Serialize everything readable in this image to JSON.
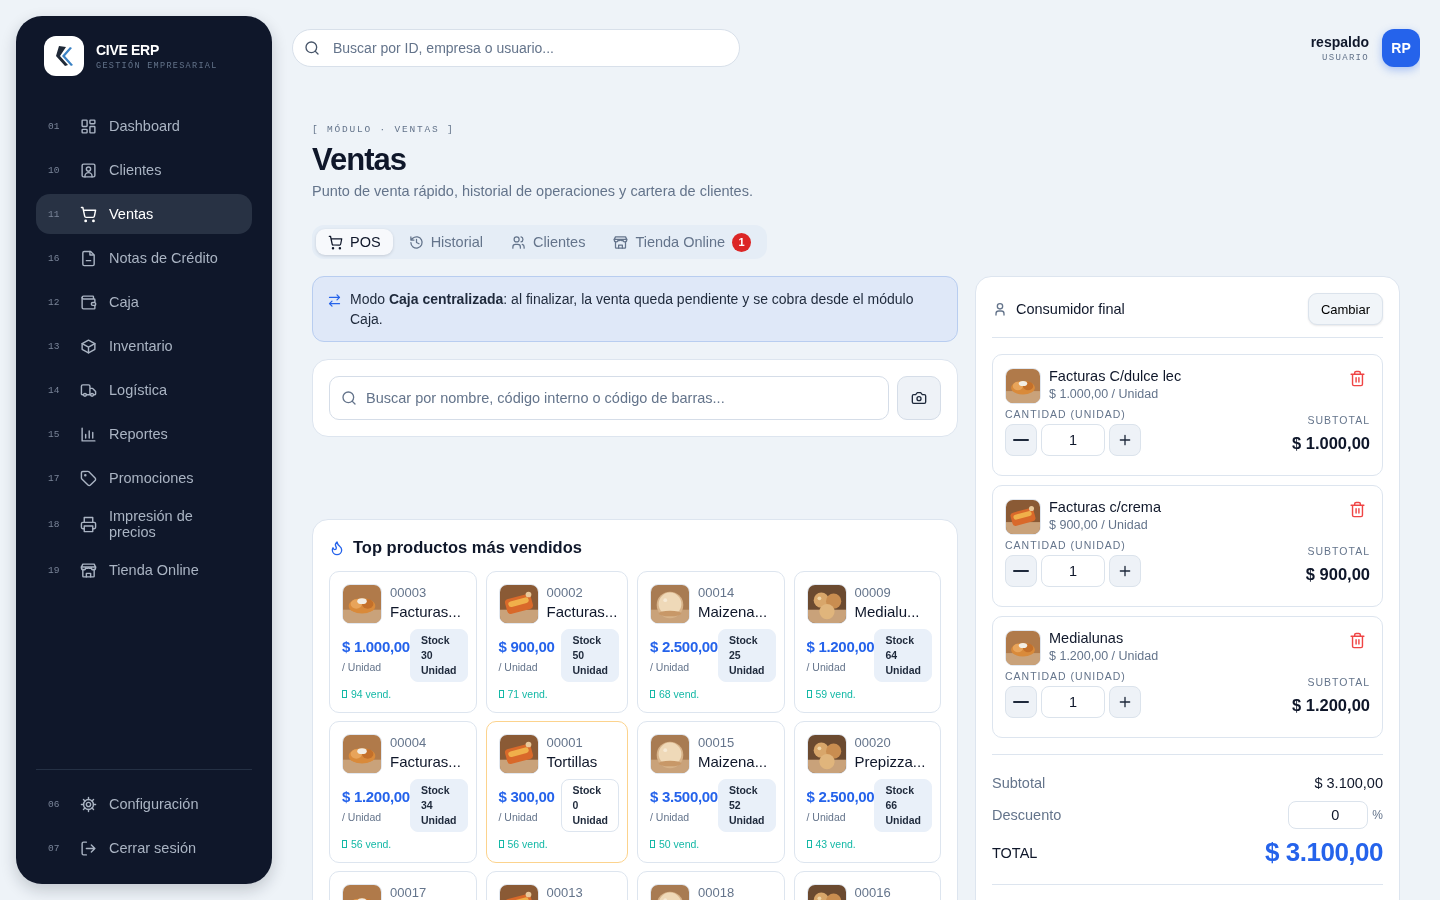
{
  "sidebar": {
    "brand": "CIVE ERP",
    "tagline": "GESTIÓN EMPRESARIAL",
    "items": [
      {
        "number": "01",
        "label": "Dashboard",
        "selected": false
      },
      {
        "number": "10",
        "label": "Clientes",
        "selected": false
      },
      {
        "number": "11",
        "label": "Ventas",
        "selected": true
      },
      {
        "number": "16",
        "label": "Notas de Crédito",
        "selected": false
      },
      {
        "number": "12",
        "label": "Caja",
        "selected": false
      },
      {
        "number": "13",
        "label": "Inventario",
        "selected": false
      },
      {
        "number": "14",
        "label": "Logística",
        "selected": false
      },
      {
        "number": "15",
        "label": "Reportes",
        "selected": false
      },
      {
        "number": "17",
        "label": "Promociones",
        "selected": false
      },
      {
        "number": "18",
        "label": "Impresión de precios",
        "selected": false
      },
      {
        "number": "19",
        "label": "Tienda Online",
        "selected": false
      }
    ],
    "footer_items": [
      {
        "number": "06",
        "label": "Configuración"
      },
      {
        "number": "07",
        "label": "Cerrar sesión"
      }
    ]
  },
  "topbar": {
    "search": {
      "placeholder": "Buscar por ID, empresa o usuario..."
    },
    "user": {
      "name": "respaldo",
      "role": "USUARIO",
      "initials": "RP"
    }
  },
  "header": {
    "breadcrumb": "[ MÓDULO · VENTAS ]",
    "title": "Ventas",
    "subtitle": "Punto de venta rápido, historial de operaciones y cartera de clientes."
  },
  "tabs": [
    {
      "label": "POS",
      "selected": true
    },
    {
      "label": "Historial",
      "selected": false
    },
    {
      "label": "Clientes",
      "selected": false
    },
    {
      "label": "Tienda Online",
      "selected": false,
      "badge": "1"
    }
  ],
  "notice": "Modo **Caja centralizada**: al finalizar, la venta queda pendiente y se cobra desde el módulo Caja.",
  "product_search": {
    "placeholder": "Buscar por nombre, código interno o código de barras..."
  },
  "top_products": {
    "title": "Top productos más vendidos",
    "products": [
      {
        "code": "00003",
        "name": "Facturas...",
        "price": "$ 1.000,00",
        "unit": "/ Unidad",
        "stock": "Stock\n30\nUnidad",
        "sold": "94 vend.",
        "out_of_stock": false
      },
      {
        "code": "00002",
        "name": "Facturas...",
        "price": "$ 900,00",
        "unit": "/ Unidad",
        "stock": "Stock\n50\nUnidad",
        "sold": "71 vend.",
        "out_of_stock": false
      },
      {
        "code": "00014",
        "name": "Maizena...",
        "price": "$ 2.500,00",
        "unit": "/ Unidad",
        "stock": "Stock\n25\nUnidad",
        "sold": "68 vend.",
        "out_of_stock": false
      },
      {
        "code": "00009",
        "name": "Medialu...",
        "price": "$ 1.200,00",
        "unit": "/ Unidad",
        "stock": "Stock\n64\nUnidad",
        "sold": "59 vend.",
        "out_of_stock": false
      },
      {
        "code": "00004",
        "name": "Facturas...",
        "price": "$ 1.200,00",
        "unit": "/ Unidad",
        "stock": "Stock\n34\nUnidad",
        "sold": "56 vend.",
        "out_of_stock": false
      },
      {
        "code": "00001",
        "name": "Tortillas",
        "price": "$ 300,00",
        "unit": "/ Unidad",
        "stock": "Stock\n0\nUnidad",
        "sold": "56 vend.",
        "out_of_stock": true
      },
      {
        "code": "00015",
        "name": "Maizena...",
        "price": "$ 3.500,00",
        "unit": "/ Unidad",
        "stock": "Stock\n52\nUnidad",
        "sold": "50 vend.",
        "out_of_stock": false
      },
      {
        "code": "00020",
        "name": "Prepizza...",
        "price": "$ 2.500,00",
        "unit": "/ Unidad",
        "stock": "Stock\n66\nUnidad",
        "sold": "43 vend.",
        "out_of_stock": false
      },
      {
        "code": "00017"
      },
      {
        "code": "00013"
      },
      {
        "code": "00018"
      },
      {
        "code": "00016"
      }
    ]
  },
  "cart": {
    "customer": "Consumidor final",
    "change_button": "Cambiar",
    "items": [
      {
        "name": "Facturas C/dulce lec",
        "unit_price": "$ 1.000,00 / Unidad",
        "quantity_label": "CANTIDAD (UNIDAD)",
        "quantity": "1",
        "subtotal_label": "SUBTOTAL",
        "subtotal": "$ 1.000,00"
      },
      {
        "name": "Facturas c/crema",
        "unit_price": "$ 900,00 / Unidad",
        "quantity_label": "CANTIDAD (UNIDAD)",
        "quantity": "1",
        "subtotal_label": "SUBTOTAL",
        "subtotal": "$ 900,00"
      },
      {
        "name": "Medialunas",
        "unit_price": "$ 1.200,00 / Unidad",
        "quantity_label": "CANTIDAD (UNIDAD)",
        "quantity": "1",
        "subtotal_label": "SUBTOTAL",
        "subtotal": "$ 1.200,00"
      }
    ],
    "subtotal_label": "Subtotal",
    "subtotal": "$ 3.100,00",
    "discount_label": "Descuento",
    "discount": "0",
    "discount_unit": "%",
    "total_label": "TOTAL",
    "total": "$ 3.100,00"
  }
}
